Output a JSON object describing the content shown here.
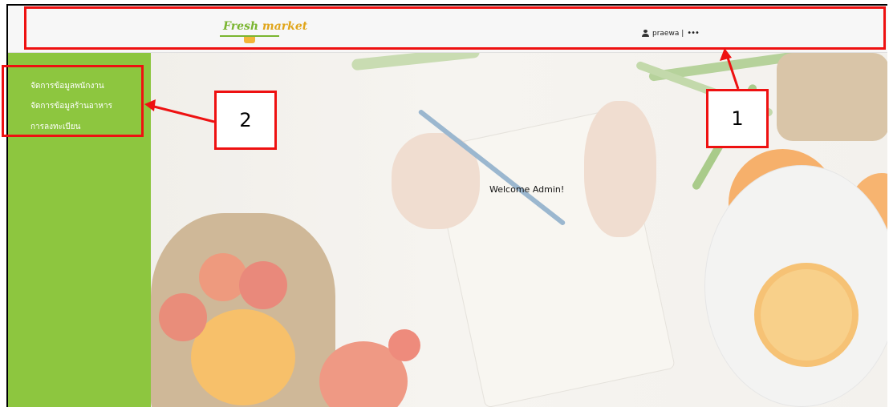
{
  "header": {
    "logo": {
      "text": "Fresh market",
      "word1": "Fresh",
      "word2": "market"
    },
    "user": {
      "name": "praewa |",
      "more": "•••"
    }
  },
  "sidebar": {
    "items": [
      {
        "label": "จัดการข้อมูลพนักงาน"
      },
      {
        "label": "จัดการข้อมูลร้านอาหาร"
      },
      {
        "label": "การลงทะเบียน"
      }
    ]
  },
  "main": {
    "welcome": "Welcome Admin!"
  },
  "annotations": {
    "label1": "1",
    "label2": "2"
  },
  "colors": {
    "sidebar": "#8dc63f",
    "annotation": "#ee1111",
    "brand": "#7ab530"
  }
}
